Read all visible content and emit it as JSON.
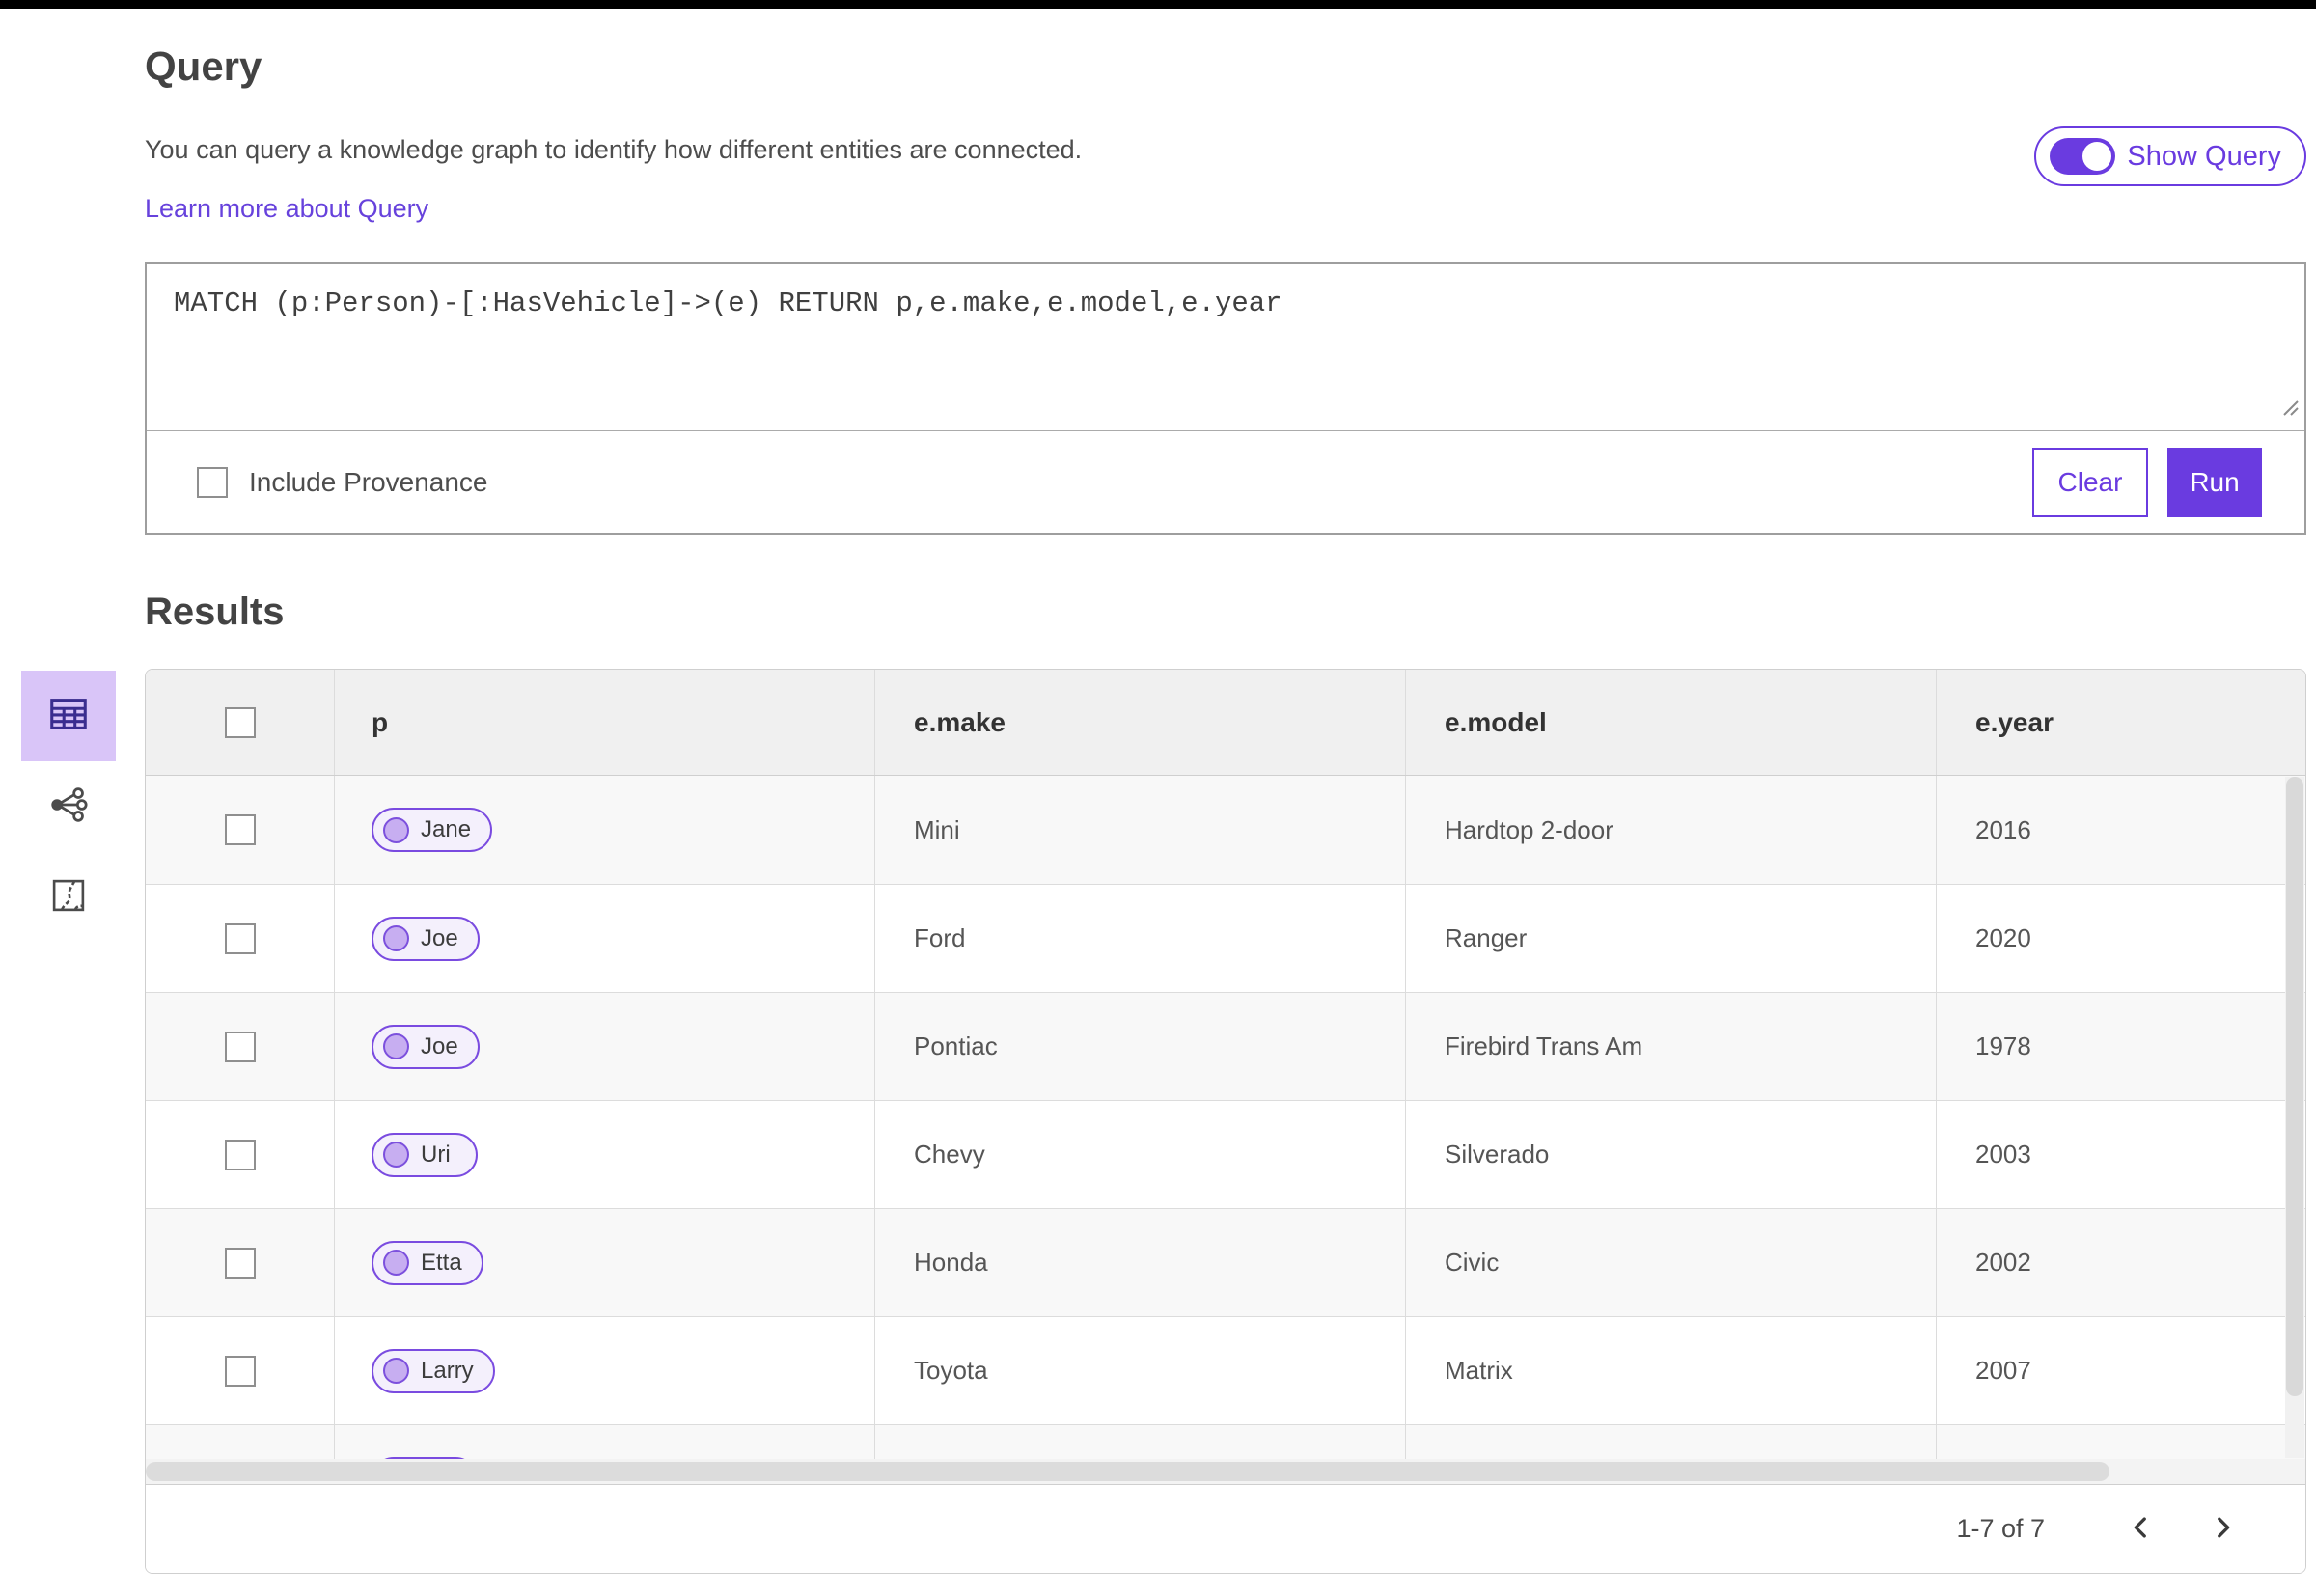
{
  "page": {
    "title": "Query",
    "description": "You can query a knowledge graph to identify how different entities are connected.",
    "learn_more_label": "Learn more about Query",
    "show_query_label": "Show Query",
    "show_query_toggle_on": true,
    "query_text": "MATCH (p:Person)-[:HasVehicle]->(e) RETURN p,e.make,e.model,e.year",
    "include_provenance_label": "Include Provenance",
    "include_provenance_checked": false,
    "clear_label": "Clear",
    "run_label": "Run",
    "results_title": "Results"
  },
  "sidebar": {
    "items": [
      {
        "name": "table-view",
        "icon": "table-icon",
        "selected": true
      },
      {
        "name": "link-chart-view",
        "icon": "link-chart-icon",
        "selected": false
      },
      {
        "name": "map-view",
        "icon": "map-icon",
        "selected": false
      }
    ]
  },
  "table": {
    "columns": [
      "p",
      "e.make",
      "e.model",
      "e.year"
    ],
    "rows": [
      {
        "p": "Jane",
        "make": "Mini",
        "model": "Hardtop 2-door",
        "year": "2016"
      },
      {
        "p": "Joe",
        "make": "Ford",
        "model": "Ranger",
        "year": "2020"
      },
      {
        "p": "Joe",
        "make": "Pontiac",
        "model": "Firebird Trans Am",
        "year": "1978"
      },
      {
        "p": "Uri",
        "make": "Chevy",
        "model": "Silverado",
        "year": "2003"
      },
      {
        "p": "Etta",
        "make": "Honda",
        "model": "Civic",
        "year": "2002"
      },
      {
        "p": "Larry",
        "make": "Toyota",
        "model": "Matrix",
        "year": "2007"
      },
      {
        "p": "",
        "make": "",
        "model": "",
        "year": ""
      }
    ]
  },
  "pagination": {
    "range_text": "1-7 of 7",
    "prev_icon": "chevron-left-icon",
    "next_icon": "chevron-right-icon"
  },
  "colors": {
    "accent_purple": "#6a3be0",
    "chip_border": "#7a4be0",
    "chip_bg": "#f4f0fc",
    "chip_node_fill": "#c7aef1",
    "selected_tool_bg": "#d9c5f8",
    "table_header_bg": "#f0f0f0",
    "row_alt_bg": "#f8f8f8",
    "top_border": "#000000"
  }
}
